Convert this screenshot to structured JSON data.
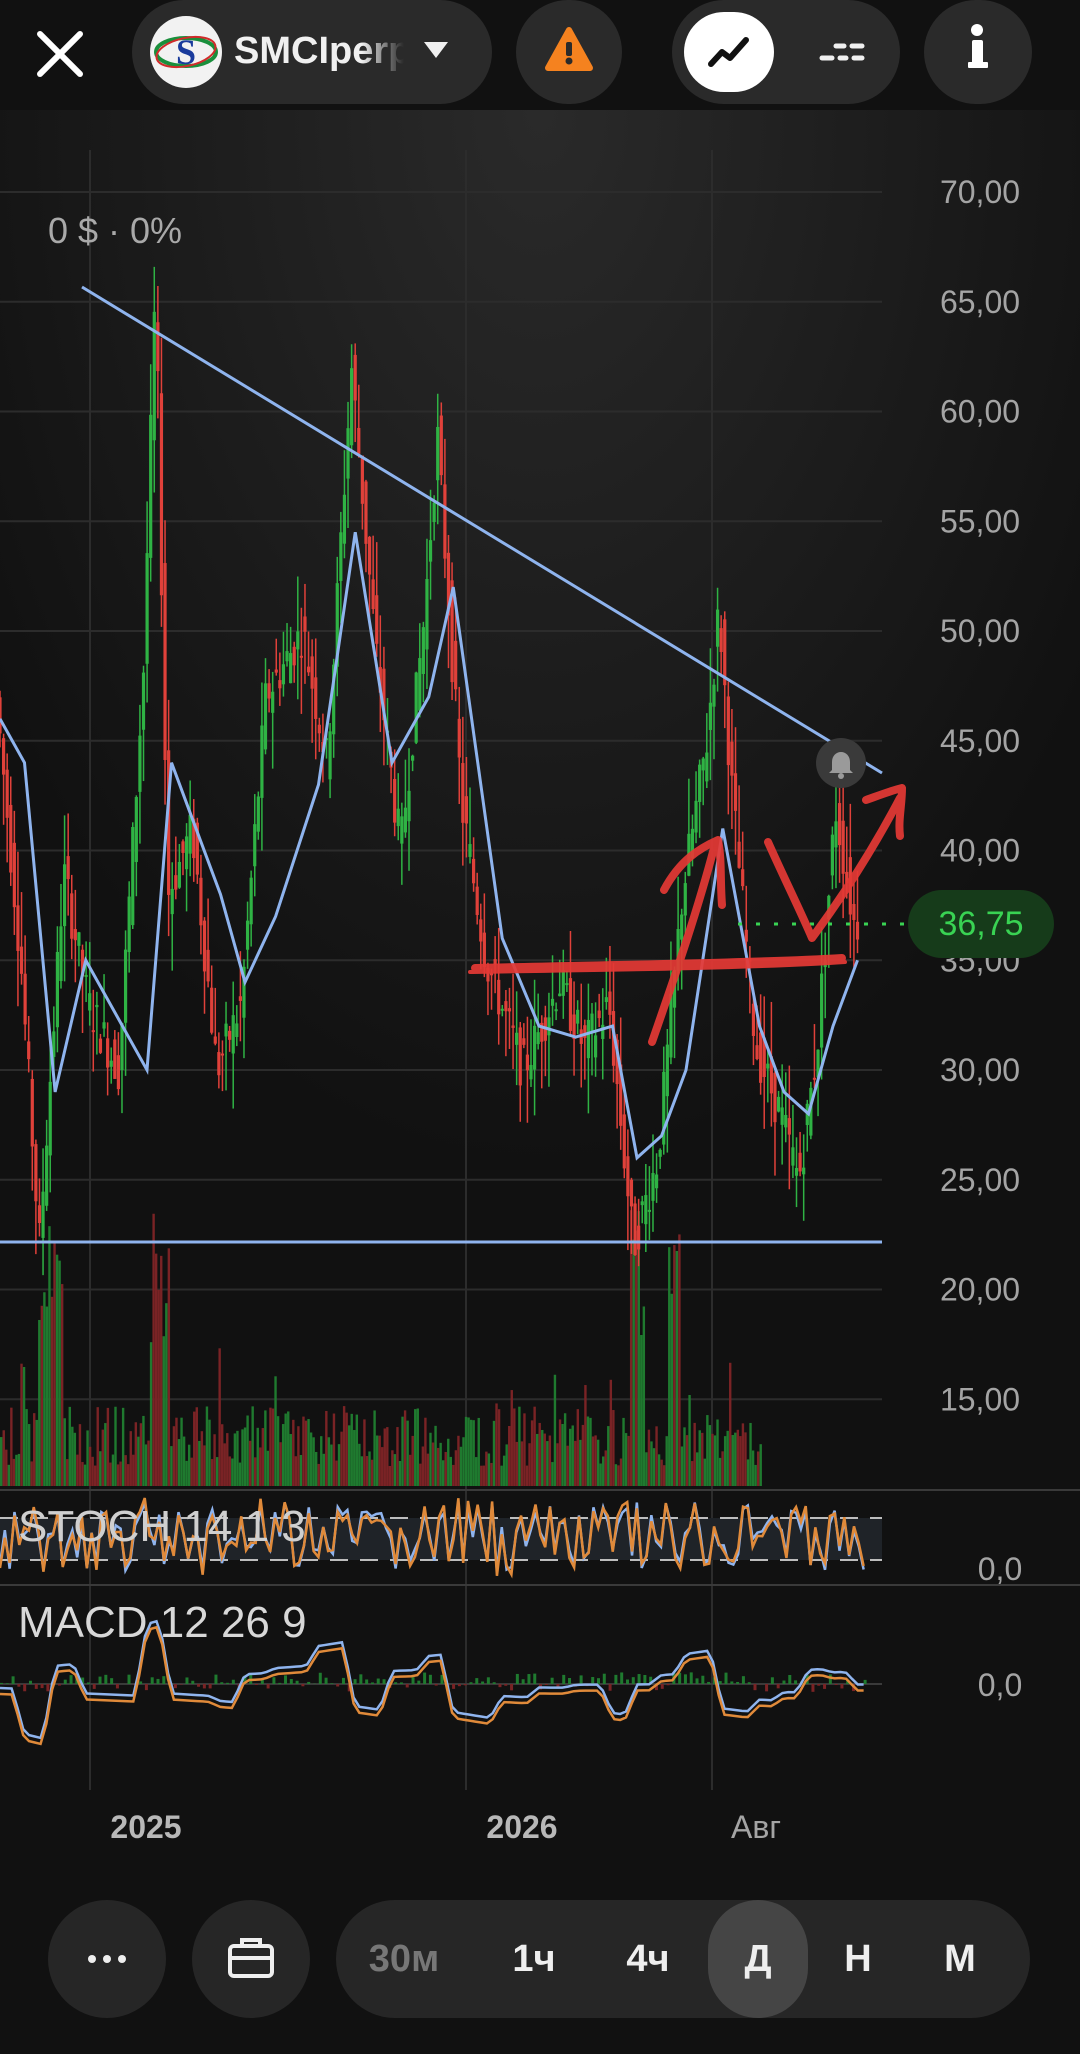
{
  "header": {
    "close_icon": "close-icon",
    "symbol": "SMCIperp",
    "symbol_logo_letter": "S",
    "warning_icon": "warning-icon",
    "chart_mode_icon": "line-chart-icon",
    "indicators_icon": "dashed-lines-icon",
    "info_icon": "info-icon"
  },
  "chart": {
    "pnl_text": "0 $ · 0%",
    "price_badge": "36,75",
    "price_color": "#39d353",
    "down_color": "#e0413a",
    "up_color": "#2fb344",
    "ma_color": "#8fb4ee",
    "annotation_color": "#e53935"
  },
  "indicators": {
    "stoch_label": "STOCH 14 1 3",
    "stoch_axis_label": "0,0",
    "macd_label": "MACD 12 26 9",
    "macd_axis_label": "0,0"
  },
  "chart_data": {
    "type": "candlestick",
    "y_axis_labels": [
      "70,00",
      "65,00",
      "60,00",
      "55,00",
      "50,00",
      "45,00",
      "40,00",
      "35,00",
      "30,00",
      "25,00",
      "20,00",
      "15,00"
    ],
    "y_values": [
      70,
      65,
      60,
      55,
      50,
      45,
      40,
      35,
      30,
      25,
      20,
      15
    ],
    "x_axis_labels": [
      "2025",
      "2026",
      "Авг"
    ],
    "last_price": 36.75,
    "horizontal_line": 22.2,
    "ma_series": [
      [
        0,
        46
      ],
      [
        0.02,
        44
      ],
      [
        0.045,
        29
      ],
      [
        0.07,
        35
      ],
      [
        0.1,
        32
      ],
      [
        0.12,
        30
      ],
      [
        0.14,
        44
      ],
      [
        0.16,
        41
      ],
      [
        0.18,
        38
      ],
      [
        0.2,
        34
      ],
      [
        0.225,
        37
      ],
      [
        0.26,
        43
      ],
      [
        0.29,
        54.5
      ],
      [
        0.32,
        44
      ],
      [
        0.35,
        47
      ],
      [
        0.37,
        52
      ],
      [
        0.39,
        44
      ],
      [
        0.41,
        36
      ],
      [
        0.44,
        32
      ],
      [
        0.47,
        31.5
      ],
      [
        0.5,
        32
      ],
      [
        0.52,
        26
      ],
      [
        0.54,
        27
      ],
      [
        0.56,
        30
      ],
      [
        0.59,
        41
      ],
      [
        0.62,
        32
      ],
      [
        0.64,
        29
      ],
      [
        0.66,
        28
      ],
      [
        0.68,
        32
      ],
      [
        0.7,
        35
      ]
    ],
    "price_path": [
      [
        0,
        47
      ],
      [
        0.02,
        35
      ],
      [
        0.035,
        22
      ],
      [
        0.055,
        39
      ],
      [
        0.075,
        33
      ],
      [
        0.1,
        30
      ],
      [
        0.12,
        48
      ],
      [
        0.13,
        66
      ],
      [
        0.14,
        38
      ],
      [
        0.16,
        41
      ],
      [
        0.18,
        30
      ],
      [
        0.2,
        33
      ],
      [
        0.22,
        47
      ],
      [
        0.25,
        50
      ],
      [
        0.27,
        44
      ],
      [
        0.29,
        62
      ],
      [
        0.31,
        49
      ],
      [
        0.33,
        40
      ],
      [
        0.35,
        51
      ],
      [
        0.36,
        59
      ],
      [
        0.38,
        42
      ],
      [
        0.4,
        35
      ],
      [
        0.43,
        30
      ],
      [
        0.46,
        34
      ],
      [
        0.48,
        31
      ],
      [
        0.5,
        33
      ],
      [
        0.52,
        22
      ],
      [
        0.54,
        26
      ],
      [
        0.56,
        38
      ],
      [
        0.58,
        45
      ],
      [
        0.59,
        51
      ],
      [
        0.6,
        43
      ],
      [
        0.62,
        31
      ],
      [
        0.64,
        28
      ],
      [
        0.655,
        25
      ],
      [
        0.67,
        31
      ],
      [
        0.685,
        42
      ],
      [
        0.7,
        36.75
      ]
    ]
  }
}
